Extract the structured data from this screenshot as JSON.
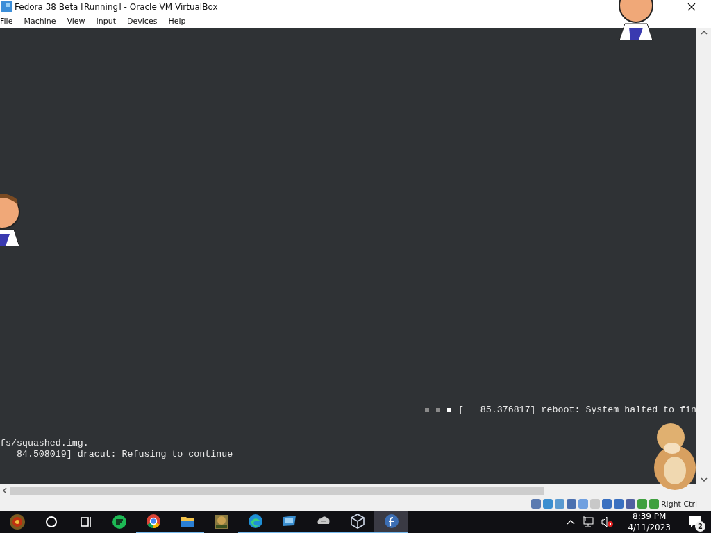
{
  "window": {
    "title": "Fedora 38 Beta [Running] - Oracle VM VirtualBox"
  },
  "menu": [
    "File",
    "Machine",
    "View",
    "Input",
    "Devices",
    "Help"
  ],
  "console": {
    "progress_dots": [
      {
        "on": false
      },
      {
        "on": false
      },
      {
        "on": true
      }
    ],
    "halt_line": "[   85.376817] reboot: System halted to fin",
    "lines": [
      "fs/squashed.img.",
      "   84.508019] dracut: Refusing to continue"
    ]
  },
  "status_bar": {
    "host_key": "Right Ctrl"
  },
  "taskbar": {
    "apps": [
      {
        "kind": "orb",
        "running": false,
        "selected": false
      },
      {
        "kind": "search",
        "running": false,
        "selected": false
      },
      {
        "kind": "taskview",
        "running": false,
        "selected": false
      },
      {
        "kind": "chat",
        "running": false,
        "selected": false
      },
      {
        "kind": "chrome",
        "running": true,
        "selected": false
      },
      {
        "kind": "folder",
        "running": true,
        "selected": false
      },
      {
        "kind": "game",
        "running": false,
        "selected": false
      },
      {
        "kind": "edge",
        "running": true,
        "selected": false
      },
      {
        "kind": "screen",
        "running": true,
        "selected": false
      },
      {
        "kind": "cloud",
        "running": true,
        "selected": false
      },
      {
        "kind": "cube",
        "running": true,
        "selected": false
      },
      {
        "kind": "fedora",
        "running": true,
        "selected": true
      }
    ],
    "time": "8:39 PM",
    "date": "4/11/2023",
    "notifications": "2"
  }
}
